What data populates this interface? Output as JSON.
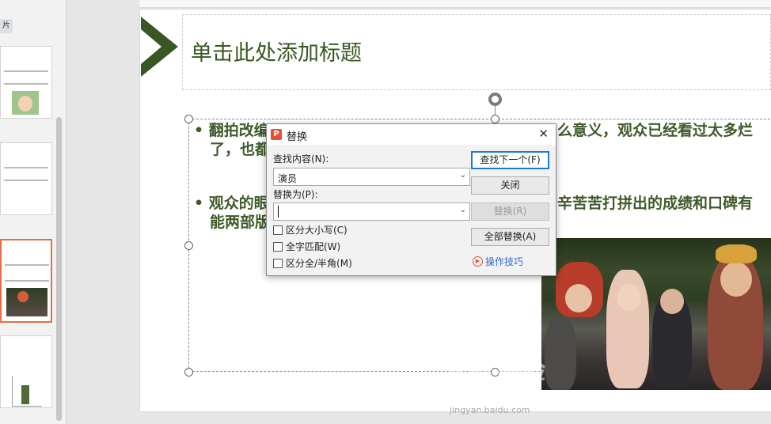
{
  "panel": {
    "tab_label": "片",
    "thumbnails": [
      {
        "line1": "说明重影:翻拍一",
        "line2": "“王诚娃”一部王"
      },
      {
        "line1": "市场。在于2000年拍成",
        "line2": "以了全部属,说等所"
      },
      {
        "line1": "时刻重构都说明得分",
        "line2": "在于中选的都用大"
      },
      {
        "line1": "",
        "line2": ""
      }
    ]
  },
  "slide": {
    "title_placeholder": "单击此处添加标题",
    "bullet1_line1": "• 翻拍改编",
    "bullet1_tail": "么意义，观众已经看过太多烂",
    "bullet1_line2": "了，也都",
    "bullet2_line1": "• 观众的眼",
    "bullet2_tail": "辛苦苦打拼出的成绩和口碑有",
    "bullet2_line2": "能两部版"
  },
  "dialog": {
    "title": "替换",
    "app_icon": "P",
    "close_label": "✕",
    "find_label": "查找内容(N):",
    "find_value": "演员",
    "replace_label": "替换为(P):",
    "replace_value": "",
    "options": [
      {
        "label": "区分大小写(C)",
        "checked": false
      },
      {
        "label": "全字匹配(W)",
        "checked": false
      },
      {
        "label": "区分全/半角(M)",
        "checked": false
      }
    ],
    "buttons": {
      "find_next": "查找下一个(F)",
      "close": "关闭",
      "replace": "替换(R)",
      "replace_all": "全部替换(A)"
    },
    "tips_label": "操作技巧"
  },
  "watermark": {
    "logo_text": "Bai 经验",
    "url": "jingyan.baidu.com"
  },
  "colors": {
    "title_green": "#385723",
    "accent_orange": "#e3522e",
    "focus_blue": "#1e78d6"
  }
}
